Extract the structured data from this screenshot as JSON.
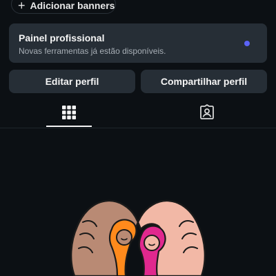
{
  "banners": {
    "add_label": "Adicionar banners",
    "icon": "plus-icon"
  },
  "pro_panel": {
    "title": "Painel profissional",
    "subtitle": "Novas ferramentas já estão disponíveis.",
    "dot_color": "#5b63f6"
  },
  "actions": {
    "edit_profile": "Editar perfil",
    "share_profile": "Compartilhar perfil"
  },
  "tabs": [
    {
      "icon": "grid-icon",
      "selected": true
    },
    {
      "icon": "tagged-person-icon",
      "selected": false
    }
  ],
  "colors": {
    "background": "#0c1014",
    "card": "#262e36",
    "text": "#f5f5f5",
    "muted_text": "#a8afb6",
    "accent": "#5b63f6"
  }
}
